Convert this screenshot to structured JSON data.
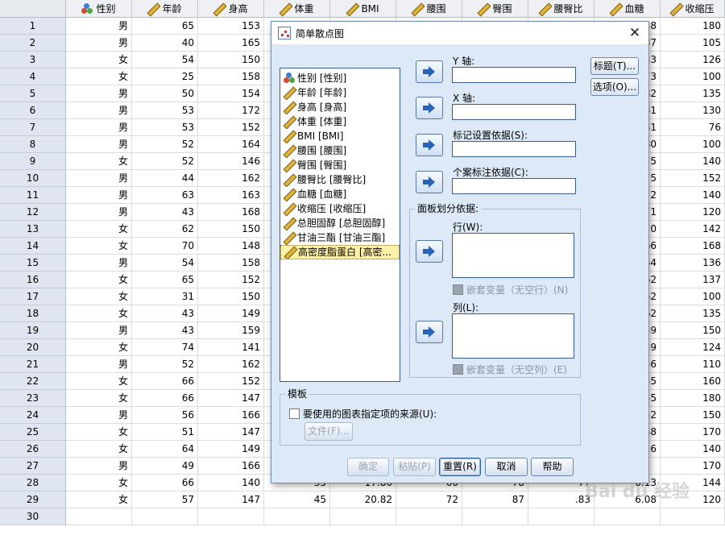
{
  "grid": {
    "columns": [
      {
        "name": "性别",
        "type": "nominal",
        "width": 82
      },
      {
        "name": "年龄",
        "type": "scale",
        "width": 82
      },
      {
        "name": "身高",
        "type": "scale",
        "width": 82
      },
      {
        "name": "体重",
        "type": "scale",
        "width": 82
      },
      {
        "name": "BMI",
        "type": "scale",
        "width": 82
      },
      {
        "name": "腰围",
        "type": "scale",
        "width": 82
      },
      {
        "name": "臀围",
        "type": "scale",
        "width": 82
      },
      {
        "name": "腰臀比",
        "type": "scale",
        "width": 82
      },
      {
        "name": "血糖",
        "type": "scale",
        "width": 82
      },
      {
        "name": "收缩压",
        "type": "scale",
        "width": 80
      }
    ],
    "rows": [
      {
        "n": "1",
        "c": [
          "男",
          "65",
          "153",
          "",
          "",
          "",
          "",
          "",
          "38",
          "180"
        ]
      },
      {
        "n": "2",
        "c": [
          "男",
          "40",
          "165",
          "",
          "",
          "",
          "",
          "",
          "87",
          "105"
        ]
      },
      {
        "n": "3",
        "c": [
          "女",
          "54",
          "150",
          "",
          "",
          "",
          "",
          "",
          "33",
          "126"
        ]
      },
      {
        "n": "4",
        "c": [
          "女",
          "25",
          "158",
          "",
          "",
          "",
          "",
          "",
          "73",
          "100"
        ]
      },
      {
        "n": "5",
        "c": [
          "男",
          "50",
          "154",
          "",
          "",
          "",
          "",
          "",
          "82",
          "135"
        ]
      },
      {
        "n": "6",
        "c": [
          "男",
          "53",
          "172",
          "",
          "",
          "",
          "",
          "",
          "81",
          "130"
        ]
      },
      {
        "n": "7",
        "c": [
          "男",
          "53",
          "152",
          "",
          "",
          "",
          "",
          "",
          "81",
          "76"
        ]
      },
      {
        "n": "8",
        "c": [
          "男",
          "52",
          "164",
          "",
          "",
          "",
          "",
          "",
          "80",
          "100"
        ]
      },
      {
        "n": "9",
        "c": [
          "女",
          "52",
          "146",
          "",
          "",
          "",
          "",
          "",
          "75",
          "140"
        ]
      },
      {
        "n": "10",
        "c": [
          "男",
          "44",
          "162",
          "",
          "",
          "",
          "",
          "",
          "75",
          "152"
        ]
      },
      {
        "n": "11",
        "c": [
          "男",
          "63",
          "163",
          "",
          "",
          "",
          "",
          "",
          "72",
          "140"
        ]
      },
      {
        "n": "12",
        "c": [
          "男",
          "43",
          "168",
          "",
          "",
          "",
          "",
          "",
          "71",
          "120"
        ]
      },
      {
        "n": "13",
        "c": [
          "女",
          "62",
          "150",
          "",
          "",
          "",
          "",
          "",
          "70",
          "142"
        ]
      },
      {
        "n": "14",
        "c": [
          "女",
          "70",
          "148",
          "",
          "",
          "",
          "",
          "",
          "66",
          "168"
        ]
      },
      {
        "n": "15",
        "c": [
          "男",
          "54",
          "158",
          "",
          "",
          "",
          "",
          "",
          "64",
          "136"
        ]
      },
      {
        "n": "16",
        "c": [
          "女",
          "65",
          "152",
          "",
          "",
          "",
          "",
          "",
          "62",
          "137"
        ]
      },
      {
        "n": "17",
        "c": [
          "女",
          "31",
          "150",
          "",
          "",
          "",
          "",
          "",
          "62",
          "100"
        ]
      },
      {
        "n": "18",
        "c": [
          "女",
          "43",
          "149",
          "",
          "",
          "",
          "",
          "",
          "62",
          "135"
        ]
      },
      {
        "n": "19",
        "c": [
          "男",
          "43",
          "159",
          "",
          "",
          "",
          "",
          "",
          "59",
          "150"
        ]
      },
      {
        "n": "20",
        "c": [
          "女",
          "74",
          "141",
          "",
          "",
          "",
          "",
          "",
          "59",
          "124"
        ]
      },
      {
        "n": "21",
        "c": [
          "男",
          "52",
          "162",
          "",
          "",
          "",
          "",
          "",
          "56",
          "110"
        ]
      },
      {
        "n": "22",
        "c": [
          "女",
          "66",
          "152",
          "",
          "",
          "",
          "",
          "",
          "55",
          "160"
        ]
      },
      {
        "n": "23",
        "c": [
          "女",
          "66",
          "147",
          "",
          "",
          "",
          "",
          "",
          "55",
          "180"
        ]
      },
      {
        "n": "24",
        "c": [
          "男",
          "56",
          "166",
          "",
          "",
          "",
          "",
          "",
          "52",
          "150"
        ]
      },
      {
        "n": "25",
        "c": [
          "女",
          "51",
          "147",
          "",
          "",
          "",
          "",
          "",
          "48",
          "170"
        ]
      },
      {
        "n": "26",
        "c": [
          "女",
          "64",
          "149",
          "",
          "",
          "",
          "",
          "",
          "16",
          "140"
        ]
      },
      {
        "n": "27",
        "c": [
          "男",
          "49",
          "166",
          "77",
          "27.94",
          "102",
          "101",
          "",
          "",
          "170"
        ]
      },
      {
        "n": "28",
        "c": [
          "女",
          "66",
          "140",
          "35",
          "17.86",
          "60",
          "78",
          "77",
          "6.13",
          "144"
        ]
      },
      {
        "n": "29",
        "c": [
          "女",
          "57",
          "147",
          "45",
          "20.82",
          "72",
          "87",
          ".83",
          "6.08",
          "120"
        ]
      },
      {
        "n": "30",
        "c": [
          "",
          "",
          "",
          "",
          "",
          "",
          "",
          "",
          "",
          ""
        ]
      }
    ]
  },
  "dialog": {
    "title": "简单散点图",
    "close_glyph": "✕",
    "variables": [
      {
        "label": "性别 [性别]",
        "type": "nominal"
      },
      {
        "label": "年龄 [年龄]",
        "type": "scale"
      },
      {
        "label": "身高 [身高]",
        "type": "scale"
      },
      {
        "label": "体重 [体重]",
        "type": "scale"
      },
      {
        "label": "BMI [BMI]",
        "type": "scale"
      },
      {
        "label": "腰围 [腰围]",
        "type": "scale"
      },
      {
        "label": "臀围 [臀围]",
        "type": "scale"
      },
      {
        "label": "腰臀比 [腰臀比]",
        "type": "scale"
      },
      {
        "label": "血糖 [血糖]",
        "type": "scale"
      },
      {
        "label": "收缩压 [收缩压]",
        "type": "scale"
      },
      {
        "label": "总胆固醇 [总胆固醇]",
        "type": "scale"
      },
      {
        "label": "甘油三酯 [甘油三酯]",
        "type": "scale"
      },
      {
        "label": "高密度脂蛋白 [高密...",
        "type": "scale"
      }
    ],
    "selected_variable_index": 12,
    "y_axis_label": "Y 轴:",
    "x_axis_label": "X 轴:",
    "markers_label": "标记设置依据(S):",
    "case_label": "个案标注依据(C):",
    "titles_button": "标题(T)...",
    "options_button": "选项(O)...",
    "panel_group_label": "面板划分依据:",
    "rows_label": "行(W):",
    "nest_rows_label": "嵌套变量（无空行）(N)",
    "cols_label": "列(L):",
    "nest_cols_label": "嵌套变量（无空列）(E)",
    "template_group_label": "模板",
    "template_checkbox_label": "要使用的图表指定项的来源(U):",
    "file_button": "文件(F)...",
    "ok_button": "确定",
    "paste_button": "粘贴(P)",
    "reset_button": "重置(R)",
    "cancel_button": "取消",
    "help_button": "帮助"
  },
  "watermark": "Bai du 经验"
}
